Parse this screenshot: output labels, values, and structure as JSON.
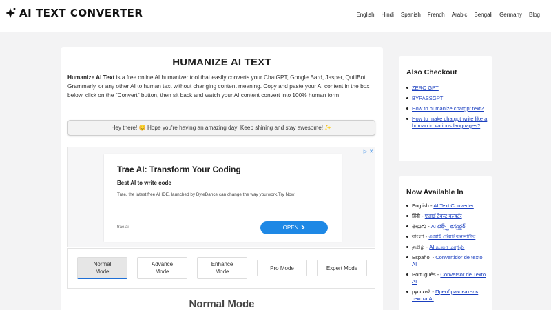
{
  "header": {
    "logo_text": "AI TEXT CONVERTER",
    "nav": [
      "English",
      "Hindi",
      "Spanish",
      "French",
      "Arabic",
      "Bengali",
      "Germany",
      "Blog"
    ]
  },
  "main": {
    "title": "HUMANIZE AI TEXT",
    "desc_bold": "Humanize AI Text",
    "desc_rest": " is a free online AI humanizer tool that easily converts your ChatGPT, Google Bard, Jasper, QuillBot, Grammarly, or any other AI to human text without changing content meaning. Copy and paste your AI content in the box below, click on the \"Convert\" button, then sit back and watch your AI content convert into 100% human form.",
    "greeting": "Hey there! 😊 Hope you're having an amazing day! Keep shining and stay awesome! ✨",
    "ad": {
      "title": "Trae AI: Transform Your Coding",
      "subtitle": "Best AI to write code",
      "body": "Trae, the latest free AI IDE, launched by ByteDance can change the way you work.Try Now!",
      "domain": "trae.ai",
      "button": "OPEN",
      "button_icon": "chevron-right-icon",
      "corner_icons": [
        "adchoices-icon",
        "close-icon"
      ]
    },
    "modes": [
      {
        "label": "Normal\nMode",
        "active": true
      },
      {
        "label": "Advance\nMode",
        "active": false
      },
      {
        "label": "Enhance\nMode",
        "active": false
      },
      {
        "label": "Pro Mode",
        "active": false
      },
      {
        "label": "Expert Mode",
        "active": false
      }
    ],
    "mode_heading": "Normal Mode"
  },
  "sidebar": {
    "also_title": "Also Checkout",
    "also_items": [
      "ZERO GPT",
      "BYPASSGPT",
      "How to humanize chatgpt text?",
      "How to make chatgpt write like a human in various languages?"
    ],
    "now_title": "Now Available In",
    "languages": [
      {
        "lang": "English",
        "sep": " - ",
        "link": "AI Text Converter"
      },
      {
        "lang": "हिंदी",
        "sep": " - ",
        "link": "एआई टेक्स्ट कन्वर्टर"
      },
      {
        "lang": "తెలుగు",
        "sep": " - ",
        "link": "AI టెక్స్ట్ కన్వర్టర్"
      },
      {
        "lang": "বাংলা",
        "sep": " - ",
        "link": "এআই টেক্সট কনভার্টার"
      },
      {
        "lang": "தமிழ்",
        "sep": " - ",
        "link": "AI உரை மாற்றி"
      },
      {
        "lang": "Español",
        "sep": " - ",
        "link": "Convertidor de texto AI"
      },
      {
        "lang": "Português",
        "sep": " - ",
        "link": "Conversor de Texto AI"
      },
      {
        "lang": "русский",
        "sep": " - ",
        "link": "Преобразователь текста AI"
      }
    ]
  },
  "colors": {
    "accent": "#1e88e5",
    "link": "#1a3fbf",
    "page_bg": "#f3f3f4"
  }
}
